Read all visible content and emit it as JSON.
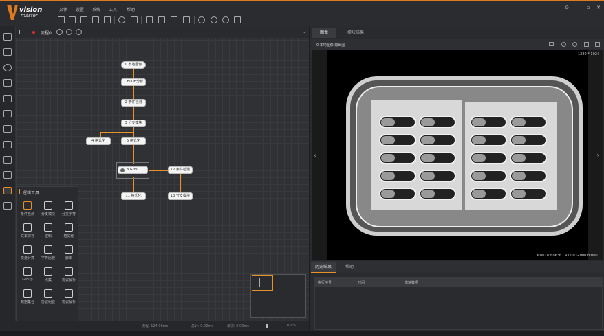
{
  "app": {
    "logo_main": "vision",
    "logo_sub": "master"
  },
  "menu": [
    "文件",
    "设置",
    "系统",
    "工具",
    "帮助"
  ],
  "toolbar_icons": [
    "new-file-icon",
    "save-icon",
    "save-as-icon",
    "import-icon",
    "export-icon",
    "screenshot-icon",
    "camera-icon",
    "display-icon",
    "ui-design-icon",
    "communication-icon",
    "global-var-icon",
    "global-script-icon",
    "run-once-icon",
    "run-loop-icon",
    "stop-icon",
    "log-icon"
  ],
  "window_controls": [
    "help-icon",
    "minimize-icon",
    "maximize-icon",
    "close-icon"
  ],
  "canvas": {
    "process_name": "流程0"
  },
  "nodes": {
    "n0": "0 本地图像",
    "n1": "1 BLOB分析",
    "n2": "2 条件检测",
    "n3": "3 分支模块",
    "n4": "4 格式化",
    "n5": "5 格式化",
    "n8": "8 Grou...",
    "n12": "12 条件检测",
    "n11": "11 格式化",
    "n13": "13 分支模块"
  },
  "toolbox": {
    "title": "逻辑工具",
    "tools": [
      {
        "label": "条件检测",
        "icon": "condition-icon"
      },
      {
        "label": "分支模块",
        "icon": "branch-icon"
      },
      {
        "label": "分支字符",
        "icon": "branch-char-icon"
      },
      {
        "label": "文本保存",
        "icon": "text-save-icon"
      },
      {
        "label": "逻辑",
        "icon": "logic-icon"
      },
      {
        "label": "格式化",
        "icon": "format-icon"
      },
      {
        "label": "变量计算",
        "icon": "var-calc-icon"
      },
      {
        "label": "字符比较",
        "icon": "str-compare-icon"
      },
      {
        "label": "脚本",
        "icon": "script-icon"
      },
      {
        "label": "Group",
        "icon": "group-icon"
      },
      {
        "label": "点集",
        "icon": "point-set-icon"
      },
      {
        "label": "协议解析",
        "icon": "protocol-parse-icon"
      },
      {
        "label": "数据集合",
        "icon": "data-set-icon"
      },
      {
        "label": "协议组装",
        "icon": "protocol-build-icon"
      },
      {
        "label": "协议解析",
        "icon": "protocol-parse-icon"
      }
    ]
  },
  "statusbar": {
    "flow_time": "流程: 114.96ms",
    "total_time": "总计: 0.00ms",
    "single_time": "单次: 0.00ms",
    "zoom": "100%"
  },
  "right_tabs": [
    "图像",
    "模块结果"
  ],
  "image_panel": {
    "title": "0 本地图像.输出图",
    "resolution": "1280 * 1024",
    "coords": "X:0010  Y:0636  |  R:000  G:000  B:000"
  },
  "bottom_tabs": [
    "历史结果",
    "帮助"
  ],
  "history_headers": [
    "执行序号",
    "时间",
    "模块数据"
  ],
  "colors": {
    "accent": "#e8902a",
    "bg": "#2a2b2e"
  }
}
